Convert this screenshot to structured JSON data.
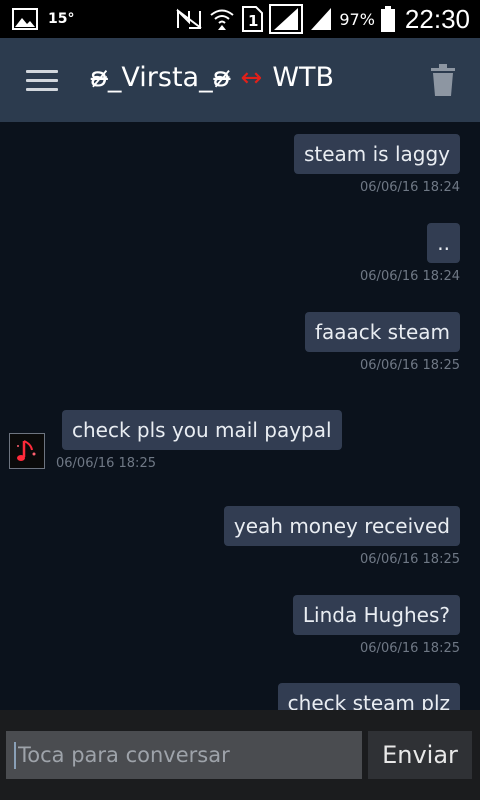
{
  "status_bar": {
    "temperature": "15°",
    "sim_label": "1",
    "battery": "97%",
    "time": "22:30"
  },
  "header": {
    "contact_name": "ʚ̴̶̷̷_Virsta_ʚ̴̶̷̷",
    "arrow": "↔",
    "other_name": "WTB"
  },
  "messages": [
    {
      "direction": "out",
      "text": "steam is laggy",
      "timestamp": "06/06/16 18:24"
    },
    {
      "direction": "out",
      "text": "..",
      "timestamp": "06/06/16 18:24"
    },
    {
      "direction": "out",
      "text": "faaack steam",
      "timestamp": "06/06/16 18:25"
    },
    {
      "direction": "in",
      "text": "check pls you mail paypal",
      "timestamp": "06/06/16 18:25"
    },
    {
      "direction": "out",
      "text": "yeah money received",
      "timestamp": "06/06/16 18:25"
    },
    {
      "direction": "out",
      "text": "Linda Hughes?",
      "timestamp": "06/06/16 18:25"
    },
    {
      "direction": "out",
      "text": "check steam plz",
      "timestamp": ""
    }
  ],
  "composer": {
    "placeholder": "Toca para conversar",
    "send_label": "Enviar"
  },
  "colors": {
    "background": "#0b121c",
    "header": "#2c3b4e",
    "bubble": "#323d52",
    "accent_arrow": "#e0201a"
  }
}
